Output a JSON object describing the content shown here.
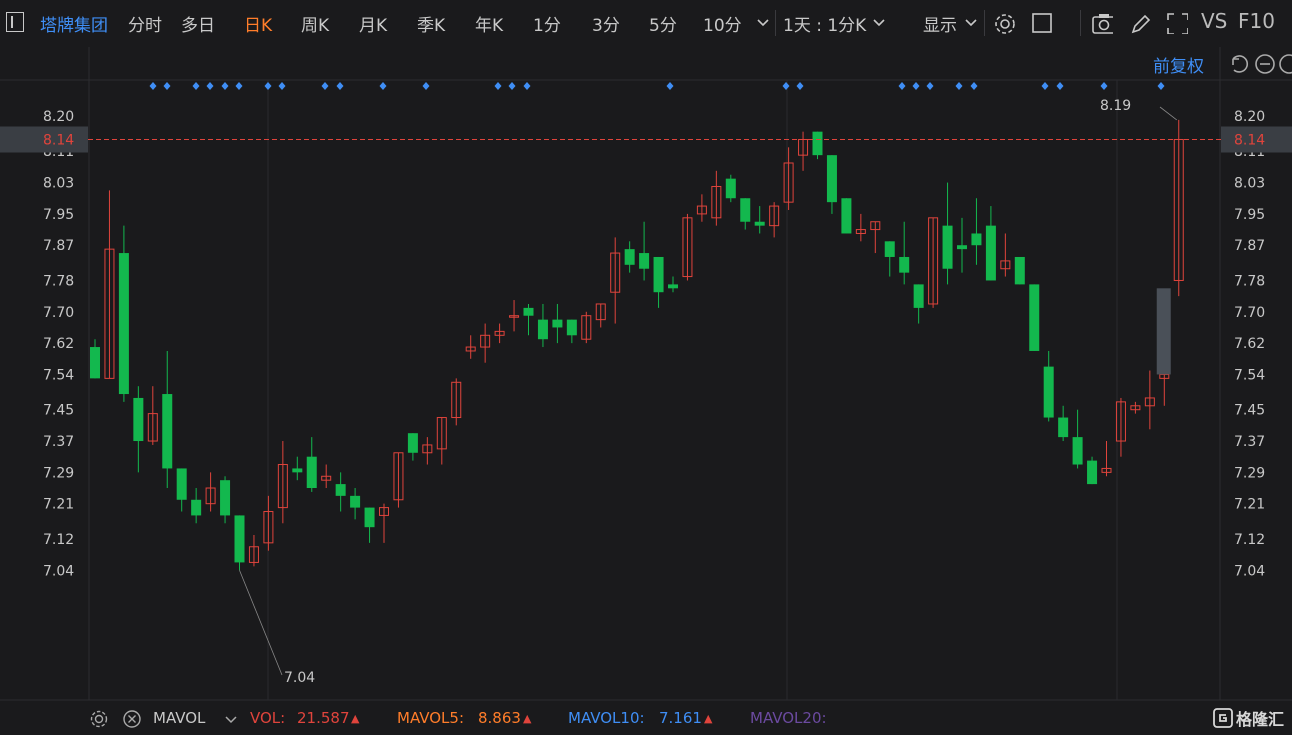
{
  "toolbar": {
    "stock_name": "塔牌集团",
    "periods": [
      "分时",
      "多日",
      "日K",
      "周K",
      "月K",
      "季K",
      "年K",
      "1分",
      "3分",
      "5分",
      "10分"
    ],
    "active_period": "日K",
    "freq_select": "1天 : 1分K",
    "display": "显示",
    "vs_label": "VS",
    "f10_label": "F10"
  },
  "adjust_label": "前复权",
  "colors": {
    "up": "#e0443c",
    "down": "#13b84e",
    "bg": "#1a1a1c",
    "accent": "#ff7d2a",
    "link": "#3f8ef5",
    "marker": "#3f8ef5",
    "current": "#e0443c"
  },
  "chart_data": {
    "type": "candlestick",
    "y_ticks": [
      "8.20",
      "8.11",
      "8.03",
      "7.95",
      "7.87",
      "7.78",
      "7.70",
      "7.62",
      "7.54",
      "7.45",
      "7.37",
      "7.29",
      "7.21",
      "7.12",
      "7.04"
    ],
    "ylim": [
      7.0,
      8.25
    ],
    "current_price": "8.14",
    "max_label": "8.19",
    "min_label": "7.04",
    "candles": [
      [
        7.61,
        7.53,
        7.53,
        7.63
      ],
      [
        7.53,
        7.86,
        7.53,
        8.01
      ],
      [
        7.85,
        7.49,
        7.47,
        7.92
      ],
      [
        7.48,
        7.37,
        7.29,
        7.51
      ],
      [
        7.37,
        7.44,
        7.36,
        7.51
      ],
      [
        7.49,
        7.3,
        7.25,
        7.6
      ],
      [
        7.3,
        7.22,
        7.19,
        7.3
      ],
      [
        7.22,
        7.18,
        7.16,
        7.25
      ],
      [
        7.21,
        7.25,
        7.19,
        7.29
      ],
      [
        7.27,
        7.18,
        7.16,
        7.28
      ],
      [
        7.18,
        7.06,
        7.04,
        7.18
      ],
      [
        7.06,
        7.1,
        7.05,
        7.13
      ],
      [
        7.11,
        7.19,
        7.09,
        7.23
      ],
      [
        7.2,
        7.31,
        7.16,
        7.37
      ],
      [
        7.3,
        7.29,
        7.27,
        7.33
      ],
      [
        7.33,
        7.25,
        7.24,
        7.38
      ],
      [
        7.27,
        7.28,
        7.25,
        7.31
      ],
      [
        7.26,
        7.23,
        7.19,
        7.29
      ],
      [
        7.23,
        7.2,
        7.17,
        7.25
      ],
      [
        7.2,
        7.15,
        7.11,
        7.2
      ],
      [
        7.18,
        7.2,
        7.11,
        7.21
      ],
      [
        7.22,
        7.34,
        7.2,
        7.34
      ],
      [
        7.39,
        7.34,
        7.32,
        7.39
      ],
      [
        7.34,
        7.36,
        7.31,
        7.38
      ],
      [
        7.35,
        7.43,
        7.31,
        7.43
      ],
      [
        7.43,
        7.52,
        7.41,
        7.53
      ],
      [
        7.6,
        7.61,
        7.58,
        7.64
      ],
      [
        7.61,
        7.64,
        7.57,
        7.67
      ],
      [
        7.64,
        7.65,
        7.62,
        7.67
      ],
      [
        7.69,
        7.69,
        7.65,
        7.73
      ],
      [
        7.71,
        7.69,
        7.64,
        7.72
      ],
      [
        7.68,
        7.63,
        7.61,
        7.72
      ],
      [
        7.68,
        7.66,
        7.62,
        7.72
      ],
      [
        7.68,
        7.64,
        7.62,
        7.68
      ],
      [
        7.63,
        7.69,
        7.62,
        7.7
      ],
      [
        7.68,
        7.72,
        7.66,
        7.72
      ],
      [
        7.75,
        7.85,
        7.67,
        7.89
      ],
      [
        7.86,
        7.82,
        7.8,
        7.88
      ],
      [
        7.85,
        7.81,
        7.78,
        7.93
      ],
      [
        7.84,
        7.75,
        7.71,
        7.84
      ],
      [
        7.77,
        7.76,
        7.75,
        7.79
      ],
      [
        7.79,
        7.94,
        7.78,
        7.95
      ],
      [
        7.95,
        7.97,
        7.93,
        8.0
      ],
      [
        7.94,
        8.02,
        7.92,
        8.06
      ],
      [
        8.04,
        7.99,
        7.98,
        8.05
      ],
      [
        7.99,
        7.93,
        7.91,
        7.99
      ],
      [
        7.93,
        7.92,
        7.9,
        7.97
      ],
      [
        7.92,
        7.97,
        7.89,
        7.98
      ],
      [
        7.98,
        8.08,
        7.96,
        8.12
      ],
      [
        8.1,
        8.14,
        8.06,
        8.16
      ],
      [
        8.16,
        8.1,
        8.09,
        8.16
      ],
      [
        8.1,
        7.98,
        7.95,
        8.1
      ],
      [
        7.99,
        7.9,
        7.9,
        7.99
      ],
      [
        7.9,
        7.91,
        7.88,
        7.95
      ],
      [
        7.91,
        7.93,
        7.85,
        7.93
      ],
      [
        7.88,
        7.84,
        7.79,
        7.88
      ],
      [
        7.84,
        7.8,
        7.77,
        7.93
      ],
      [
        7.77,
        7.71,
        7.67,
        7.77
      ],
      [
        7.72,
        7.94,
        7.71,
        7.94
      ],
      [
        7.92,
        7.81,
        7.77,
        8.03
      ],
      [
        7.87,
        7.86,
        7.8,
        7.94
      ],
      [
        7.9,
        7.87,
        7.82,
        7.99
      ],
      [
        7.92,
        7.78,
        7.78,
        7.97
      ],
      [
        7.81,
        7.83,
        7.79,
        7.9
      ],
      [
        7.84,
        7.77,
        7.77,
        7.84
      ],
      [
        7.77,
        7.6,
        7.6,
        7.77
      ],
      [
        7.56,
        7.43,
        7.42,
        7.6
      ],
      [
        7.43,
        7.38,
        7.37,
        7.46
      ],
      [
        7.38,
        7.31,
        7.3,
        7.45
      ],
      [
        7.32,
        7.26,
        7.26,
        7.33
      ],
      [
        7.29,
        7.3,
        7.28,
        7.37
      ],
      [
        7.37,
        7.47,
        7.33,
        7.48
      ],
      [
        7.45,
        7.46,
        7.44,
        7.47
      ],
      [
        7.46,
        7.48,
        7.4,
        7.55
      ],
      [
        7.53,
        7.54,
        7.46,
        7.56
      ],
      [
        7.78,
        8.14,
        7.74,
        8.19
      ]
    ],
    "markers_x": [
      153,
      167,
      196,
      210,
      225,
      239,
      268,
      282,
      325,
      340,
      383,
      426,
      498,
      512,
      527,
      670,
      786,
      800,
      902,
      916,
      930,
      959,
      974,
      1045,
      1060,
      1104,
      1161
    ]
  },
  "volume_bar": {
    "indicator": "MAVOL",
    "vol_label": "VOL:",
    "vol_value": "21.587",
    "mavol5_label": "MAVOL5:",
    "mavol5_value": "8.863",
    "mavol10_label": "MAVOL10:",
    "mavol10_value": "7.161",
    "mavol20_label": "MAVOL20:",
    "colors": {
      "vol": "#e0443c",
      "mavol5": "#ff7d2a",
      "mavol10": "#3f8ef5",
      "mavol20": "#6b4aa0"
    }
  },
  "logo": "格隆汇"
}
